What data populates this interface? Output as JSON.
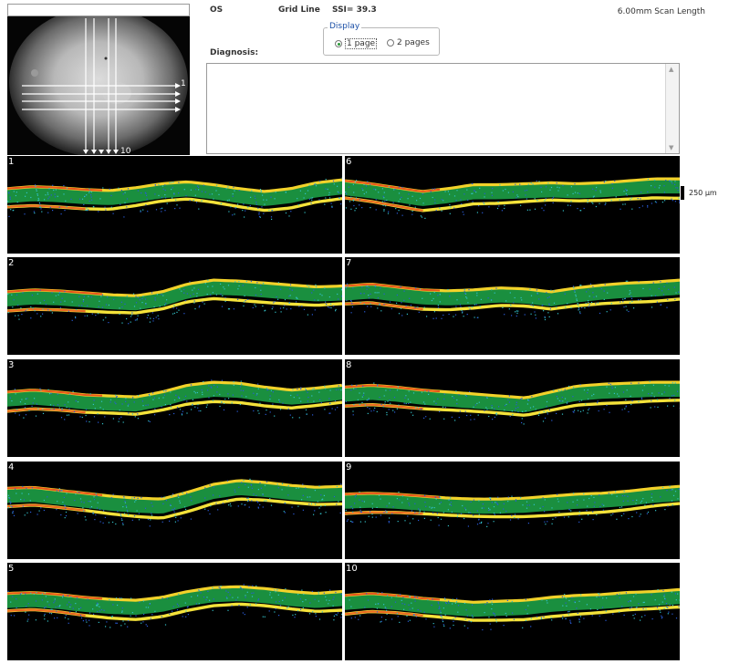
{
  "header": {
    "eye": "OS",
    "grid_line": "Grid Line",
    "ssi": "SSI= 39.3",
    "scan_length": "6.00mm Scan Length"
  },
  "display": {
    "legend": "Display",
    "options": [
      {
        "label": "1 page",
        "selected": true
      },
      {
        "label": "2 pages",
        "selected": false
      }
    ]
  },
  "diagnosis": {
    "label": "Diagnosis:",
    "value": ""
  },
  "fundus": {
    "marker_1": "1",
    "marker_10": "10"
  },
  "scale": {
    "label": "250 µm"
  },
  "scans": [
    {
      "number": "1",
      "profile": [
        0.4,
        0.38,
        0.39,
        0.41,
        0.42,
        0.39,
        0.35,
        0.33,
        0.36,
        0.4,
        0.43,
        0.4,
        0.34,
        0.31
      ]
    },
    {
      "number": "2",
      "profile": [
        0.42,
        0.4,
        0.41,
        0.43,
        0.45,
        0.46,
        0.42,
        0.34,
        0.3,
        0.31,
        0.33,
        0.35,
        0.37,
        0.36
      ]
    },
    {
      "number": "3",
      "profile": [
        0.4,
        0.38,
        0.4,
        0.43,
        0.44,
        0.45,
        0.4,
        0.33,
        0.3,
        0.31,
        0.35,
        0.38,
        0.36,
        0.33
      ]
    },
    {
      "number": "4",
      "profile": [
        0.34,
        0.33,
        0.36,
        0.39,
        0.42,
        0.44,
        0.45,
        0.38,
        0.3,
        0.26,
        0.28,
        0.31,
        0.33,
        0.32
      ]
    },
    {
      "number": "5",
      "profile": [
        0.38,
        0.37,
        0.39,
        0.42,
        0.44,
        0.45,
        0.42,
        0.36,
        0.32,
        0.31,
        0.33,
        0.36,
        0.38,
        0.36
      ]
    },
    {
      "number": "6",
      "profile": [
        0.32,
        0.35,
        0.39,
        0.43,
        0.4,
        0.36,
        0.36,
        0.35,
        0.34,
        0.35,
        0.34,
        0.32,
        0.3,
        0.3
      ]
    },
    {
      "number": "7",
      "profile": [
        0.36,
        0.34,
        0.37,
        0.4,
        0.41,
        0.4,
        0.38,
        0.39,
        0.42,
        0.38,
        0.35,
        0.33,
        0.32,
        0.3
      ]
    },
    {
      "number": "8",
      "profile": [
        0.35,
        0.33,
        0.35,
        0.38,
        0.4,
        0.42,
        0.44,
        0.46,
        0.4,
        0.34,
        0.32,
        0.31,
        0.3,
        0.3
      ]
    },
    {
      "number": "9",
      "profile": [
        0.4,
        0.39,
        0.4,
        0.42,
        0.44,
        0.45,
        0.45,
        0.44,
        0.42,
        0.4,
        0.39,
        0.37,
        0.34,
        0.32
      ]
    },
    {
      "number": "10",
      "profile": [
        0.4,
        0.38,
        0.4,
        0.43,
        0.45,
        0.47,
        0.46,
        0.45,
        0.42,
        0.4,
        0.39,
        0.37,
        0.36,
        0.34
      ]
    }
  ]
}
